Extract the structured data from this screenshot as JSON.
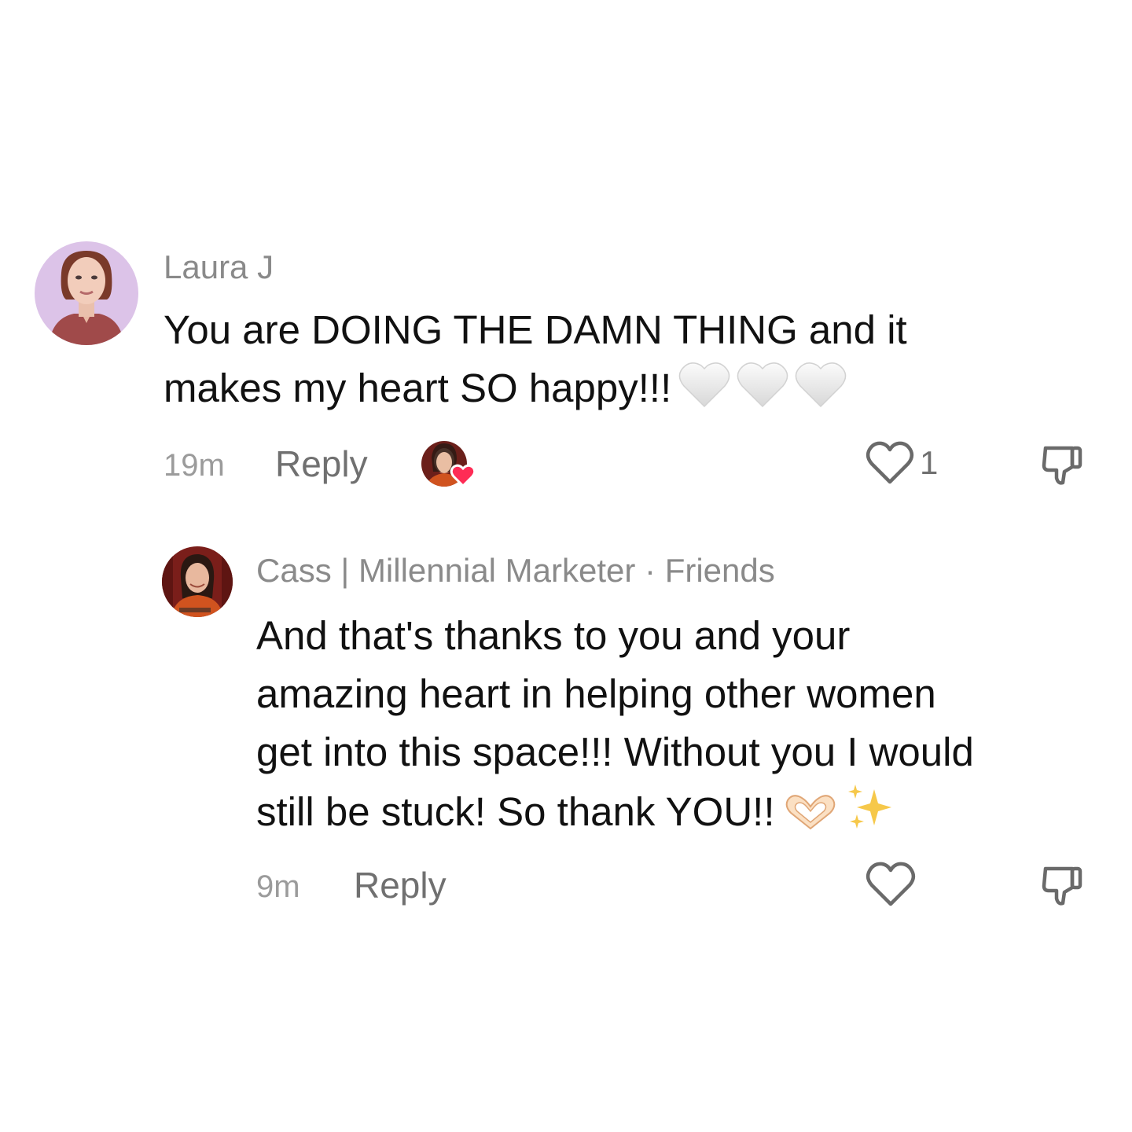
{
  "comments": [
    {
      "username": "Laura J",
      "text_lines": [
        "You are DOING THE DAMN THING and it",
        "makes my heart SO happy!!!"
      ],
      "emojis": [
        "white-heart",
        "white-heart",
        "white-heart"
      ],
      "time": "19m",
      "reply_label": "Reply",
      "like_count": "1",
      "liked_by_creator": true
    },
    {
      "username": "Cass | Millennial Marketer · Friends",
      "text_lines": [
        "And that's thanks to you and your",
        "amazing heart in helping other women",
        "get into this space!!! Without you I would",
        "still be stuck! So thank YOU!!"
      ],
      "emojis": [
        "heart-hands",
        "sparkles"
      ],
      "time": "9m",
      "reply_label": "Reply"
    }
  ],
  "colors": {
    "username": "#8a8a8a",
    "text": "#111111",
    "muted": "#9b9b9b",
    "reply": "#707070",
    "icon": "#6a6a6a",
    "creator_heart": "#fe2c55",
    "laura_avatar_bg": "#dcc3e8",
    "cass_avatar_bg": "#7a1e1a"
  },
  "icons": {
    "like": "heart-outline-icon",
    "dislike": "thumbs-down-icon",
    "creator_like_badge": "red-heart-icon"
  }
}
